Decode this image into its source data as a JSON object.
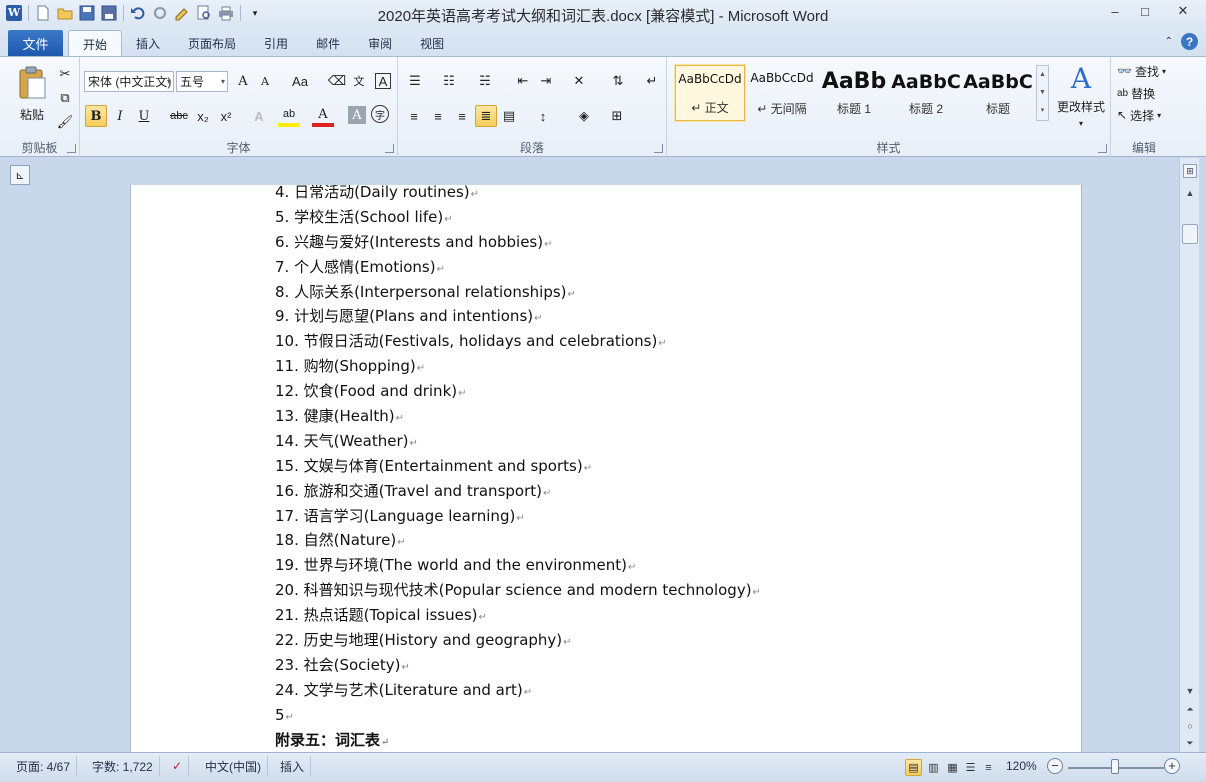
{
  "window": {
    "title": "2020年英语高考考试大纲和词汇表.docx [兼容模式] - Microsoft Word",
    "minimize": "–",
    "maximize": "□",
    "close": "✕"
  },
  "qat": {
    "logo": "W",
    "icons": [
      "new-document-icon",
      "open-folder-icon",
      "save-icon",
      "save-as-icon",
      "undo-icon",
      "redo-icon",
      "format-painter-icon",
      "print-preview-icon",
      "print-icon",
      "customize-icon"
    ]
  },
  "tabs": {
    "file": "文件",
    "items": [
      "开始",
      "插入",
      "页面布局",
      "引用",
      "邮件",
      "审阅",
      "视图"
    ],
    "active_index": 0
  },
  "ribbon": {
    "clipboard": {
      "label": "剪贴板",
      "paste": "粘贴"
    },
    "font": {
      "label": "字体",
      "font_name": "宋体 (中文正文)",
      "font_size": "五号",
      "grow": "A",
      "shrink": "A",
      "case": "Aa",
      "bold": "B",
      "italic": "I",
      "underline": "U",
      "strike": "abc",
      "subscript": "x₂",
      "superscript": "x²",
      "highlight": "ab",
      "font_color": "A",
      "char_shading": "A",
      "enclose": "字"
    },
    "paragraph": {
      "label": "段落"
    },
    "styles": {
      "label": "样式",
      "items": [
        {
          "sample": "AaBbCcDd",
          "name": "↵ 正文",
          "size": "12px",
          "bold": false
        },
        {
          "sample": "AaBbCcDd",
          "name": "↵ 无间隔",
          "size": "12px",
          "bold": false
        },
        {
          "sample": "AaBb",
          "name": "标题 1",
          "size": "22px",
          "bold": true
        },
        {
          "sample": "AaBbC",
          "name": "标题 2",
          "size": "19px",
          "bold": true
        },
        {
          "sample": "AaBbC",
          "name": "标题",
          "size": "19px",
          "bold": true
        }
      ],
      "change_styles": "更改样式"
    },
    "editing": {
      "label": "编辑",
      "find": "查找",
      "replace": "替换",
      "select": "选择"
    }
  },
  "document": {
    "lines": [
      "4.  日常活动(Daily routines)",
      "5.  学校生活(School life)",
      "6.  兴趣与爱好(Interests and hobbies)",
      "7.  个人感情(Emotions)",
      "8.  人际关系(Interpersonal relationships)",
      "9.  计划与愿望(Plans and intentions)",
      "10.  节假日活动(Festivals, holidays and celebrations)",
      "11.  购物(Shopping)",
      "12.  饮食(Food and drink)",
      "13.  健康(Health)",
      "14.  天气(Weather)",
      "15.  文娱与体育(Entertainment and sports)",
      "16.  旅游和交通(Travel and transport)",
      "17.  语言学习(Language learning)",
      "18.  自然(Nature)",
      "19.  世界与环境(The world and the environment)",
      "20.  科普知识与现代技术(Popular science and modern technology)",
      "21.  热点话题(Topical issues)",
      "22.  历史与地理(History and geography)",
      "23.  社会(Society)",
      "24.  文学与艺术(Literature and art)",
      "5"
    ],
    "heading": "附录五：词汇表",
    "paragraph_mark": "↵"
  },
  "status": {
    "page": "页面: 4/67",
    "words": "字数: 1,722",
    "language": "中文(中国)",
    "mode": "插入",
    "zoom": "120%"
  }
}
